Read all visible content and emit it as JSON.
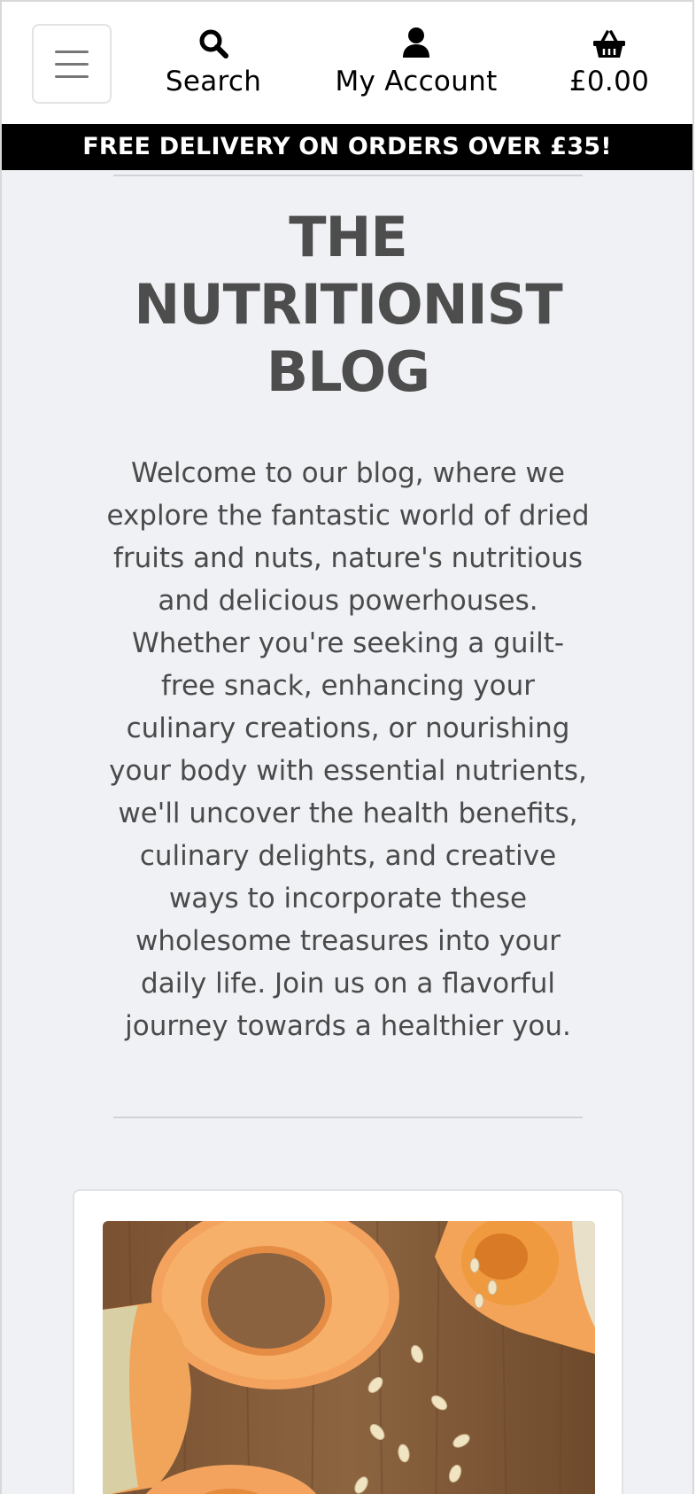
{
  "header": {
    "menu_toggle": "menu-icon",
    "search": {
      "label": "Search",
      "icon": "search-icon"
    },
    "account": {
      "label": "My Account",
      "icon": "user-icon"
    },
    "cart": {
      "label": "£0.00",
      "icon": "basket-icon"
    }
  },
  "banner": {
    "text": "FREE DELIVERY ON ORDERS OVER £35!"
  },
  "blog": {
    "title_lines": [
      "THE",
      "NUTRITIONIST",
      "BLOG"
    ],
    "intro": "Welcome to our blog, where we explore the fantastic world of dried fruits and nuts, nature's nutritious and delicious powerhouses. Whether you're seeking a guilt-free snack, enhancing your culinary creations, or nourishing your body with essential nutrients, we'll uncover the health benefits, culinary delights, and creative ways to incorporate these wholesome treasures into your daily life. Join us on a flavorful journey towards a healthier you."
  },
  "post_card": {
    "image": "butternut-squash-photo"
  },
  "colors": {
    "page_bg": "#f0f1f5",
    "banner_bg": "#000000",
    "banner_text": "#ffffff",
    "title_text": "#4d4d4d",
    "body_text": "#4a4a4a"
  }
}
